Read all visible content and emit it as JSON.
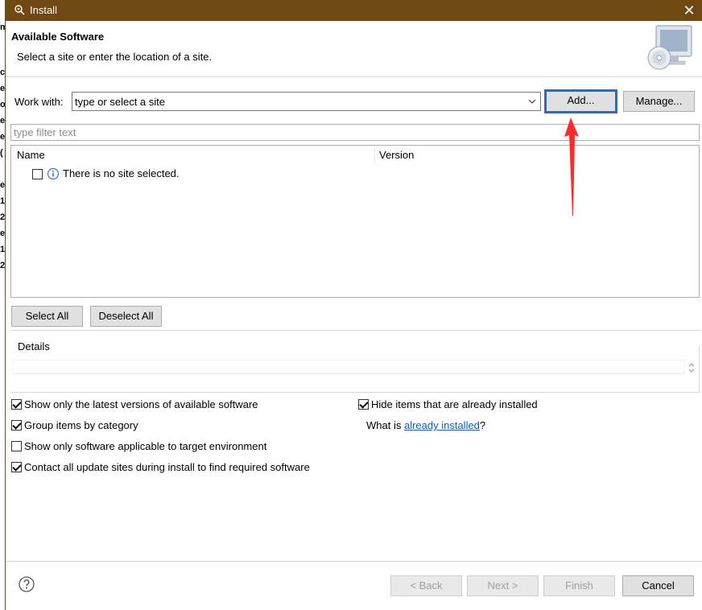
{
  "window": {
    "title": "Install",
    "close_glyph": "✕"
  },
  "banner": {
    "heading": "Available Software",
    "description": "Select a site or enter the location of a site."
  },
  "work_with": {
    "label": "Work with:",
    "value": "type or select a site",
    "add_label": "Add...",
    "manage_label": "Manage..."
  },
  "filter": {
    "placeholder": "type filter text"
  },
  "tree": {
    "columns": [
      "Name",
      "Version"
    ],
    "rows": [
      {
        "checked": false,
        "icon": "info-icon",
        "text": "There is no site selected."
      }
    ]
  },
  "selection": {
    "select_all": "Select All",
    "deselect_all": "Deselect All"
  },
  "details": {
    "label": "Details",
    "text": ""
  },
  "options": {
    "show_latest": {
      "label": "Show only the latest versions of available software",
      "checked": true
    },
    "group_by_category": {
      "label": "Group items by category",
      "checked": true
    },
    "show_applicable": {
      "label": "Show only software applicable to target environment",
      "checked": false
    },
    "contact_sites": {
      "label": "Contact all update sites during install to find required software",
      "checked": true
    },
    "hide_installed": {
      "label": "Hide items that are already installed",
      "checked": true
    }
  },
  "what_is": {
    "prefix": "What is ",
    "link": "already installed",
    "suffix": "?"
  },
  "footer": {
    "back": "< Back",
    "next": "Next >",
    "finish": "Finish",
    "cancel": "Cancel"
  },
  "colors": {
    "titlebar": "#6f4812",
    "focus_border": "#0078d7",
    "annotation": "#ff2a2a",
    "link": "#0066cc"
  }
}
